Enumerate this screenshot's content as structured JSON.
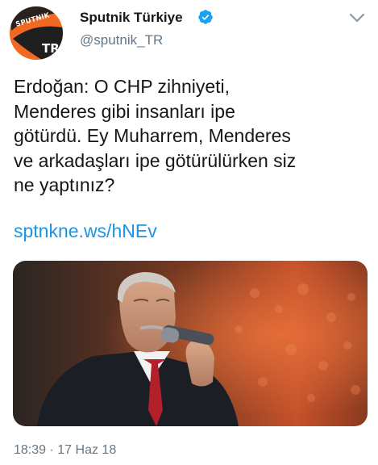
{
  "account": {
    "display_name": "Sputnik Türkiye",
    "handle": "@sputnik_TR",
    "avatar_logo_top": "SPUTNIK",
    "avatar_logo_bottom": "TR"
  },
  "tweet": {
    "lines": [
      "Erdoğan: O CHP zihniyeti,",
      "Menderes gibi insanları ipe",
      "götürdü. Ey Muharrem, Menderes",
      "ve arkadaşları ipe götürülürken siz",
      "ne yaptınız?"
    ],
    "link": "sptnkne.ws/hNEv"
  },
  "meta": {
    "time": "18:39",
    "separator": "·",
    "date": "17 Haz 18"
  },
  "colors": {
    "brand_orange": "#f26a21",
    "verified_blue": "#1da1f2",
    "link_blue": "#1b95e0",
    "secondary_text": "#657786"
  },
  "icons": {
    "verified": "verified-badge-icon",
    "menu": "chevron-down-icon"
  }
}
